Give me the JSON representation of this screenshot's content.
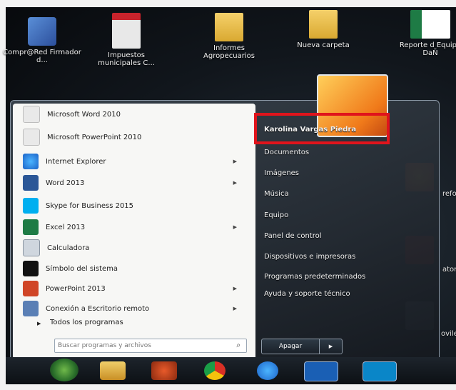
{
  "desktop_icons": [
    {
      "label": "Compr@Red Firmador d..."
    },
    {
      "label": "Impuestos municipales C..."
    },
    {
      "label": "Informes Agropecuarios"
    },
    {
      "label": "Nueva carpeta"
    },
    {
      "label": "Reporte d Equipo DaÑ"
    }
  ],
  "start_menu": {
    "programs": [
      {
        "label": "Microsoft Word 2010",
        "icon": "document-icon",
        "has_submenu": false
      },
      {
        "label": "Microsoft PowerPoint 2010",
        "icon": "document-icon",
        "has_submenu": false
      },
      {
        "label": "Internet Explorer",
        "icon": "internet-explorer-icon",
        "has_submenu": true
      },
      {
        "label": "Word 2013",
        "icon": "word-icon",
        "has_submenu": true
      },
      {
        "label": "Skype for Business 2015",
        "icon": "skype-icon",
        "has_submenu": false
      },
      {
        "label": "Excel 2013",
        "icon": "excel-icon",
        "has_submenu": true
      },
      {
        "label": "Calculadora",
        "icon": "calculator-icon",
        "has_submenu": false
      },
      {
        "label": "Símbolo del sistema",
        "icon": "command-prompt-icon",
        "has_submenu": false
      },
      {
        "label": "PowerPoint 2013",
        "icon": "powerpoint-icon",
        "has_submenu": true
      },
      {
        "label": "Conexión a Escritorio remoto",
        "icon": "remote-desktop-icon",
        "has_submenu": true
      }
    ],
    "all_programs": "Todos los programas",
    "search_placeholder": "Buscar programas y archivos",
    "user_name": "Karolina Vargas Piedra",
    "right_links": [
      "Documentos",
      "Imágenes",
      "Música",
      "Equipo",
      "Panel de control",
      "Dispositivos e impresoras",
      "Programas predeterminados",
      "Ayuda y soporte técnico"
    ],
    "shutdown_label": "Apagar"
  },
  "background_fragments": {
    "right_edge_1": "refo",
    "right_edge_2": "ator",
    "right_edge_3": "ovile"
  },
  "colors": {
    "highlight_box": "#e0141c",
    "menu_left_pane": "#f7f7f5"
  }
}
